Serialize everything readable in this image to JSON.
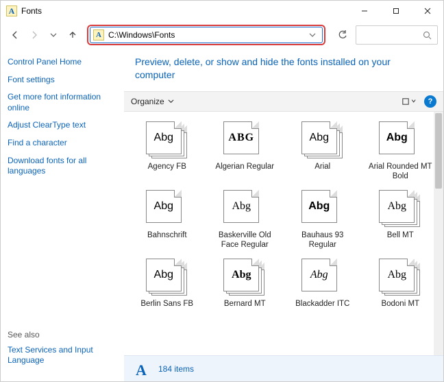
{
  "window": {
    "title": "Fonts"
  },
  "address": {
    "path": "C:\\Windows\\Fonts"
  },
  "sidebar": {
    "links": [
      "Control Panel Home",
      "Font settings",
      "Get more font information online",
      "Adjust ClearType text",
      "Find a character",
      "Download fonts for all languages"
    ],
    "see_also_label": "See also",
    "see_also_links": [
      "Text Services and Input Language"
    ]
  },
  "main": {
    "heading": "Preview, delete, or show and hide the fonts installed on your computer",
    "organize_label": "Organize"
  },
  "fonts": [
    {
      "name": "Agency FB",
      "sample": "Abg",
      "stack": true,
      "style": "font-family: 'Agency FB', Arial Narrow, sans-serif; font-stretch: condensed;"
    },
    {
      "name": "Algerian Regular",
      "sample": "ABG",
      "stack": false,
      "style": "font-family: Algerian, 'Wide Latin', serif; font-weight: bold; letter-spacing: 1px;"
    },
    {
      "name": "Arial",
      "sample": "Abg",
      "stack": true,
      "style": "font-family: Arial, sans-serif;"
    },
    {
      "name": "Arial Rounded MT Bold",
      "sample": "Abg",
      "stack": false,
      "style": "font-family: 'Arial Rounded MT Bold', Arial, sans-serif; font-weight: bold;"
    },
    {
      "name": "Bahnschrift",
      "sample": "Abg",
      "stack": false,
      "style": "font-family: Bahnschrift, Arial, sans-serif;"
    },
    {
      "name": "Baskerville Old Face Regular",
      "sample": "Abg",
      "stack": false,
      "style": "font-family: 'Baskerville Old Face', Georgia, serif;"
    },
    {
      "name": "Bauhaus 93 Regular",
      "sample": "Abg",
      "stack": false,
      "style": "font-family: 'Bauhaus 93', Impact, sans-serif; font-weight: bold;"
    },
    {
      "name": "Bell MT",
      "sample": "Abg",
      "stack": true,
      "style": "font-family: 'Bell MT', Georgia, serif;"
    },
    {
      "name": "Berlin Sans FB",
      "sample": "Abg",
      "stack": true,
      "style": "font-family: 'Berlin Sans FB', Arial, sans-serif;"
    },
    {
      "name": "Bernard MT",
      "sample": "Abg",
      "stack": true,
      "style": "font-family: 'Bernard MT Condensed', Impact, serif; font-weight: bold;"
    },
    {
      "name": "Blackadder ITC",
      "sample": "Abg",
      "stack": false,
      "style": "font-family: 'Blackadder ITC', cursive; font-style: italic;"
    },
    {
      "name": "Bodoni MT",
      "sample": "Abg",
      "stack": true,
      "style": "font-family: 'Bodoni MT', Georgia, serif;"
    }
  ],
  "status": {
    "count_text": "184 items"
  }
}
